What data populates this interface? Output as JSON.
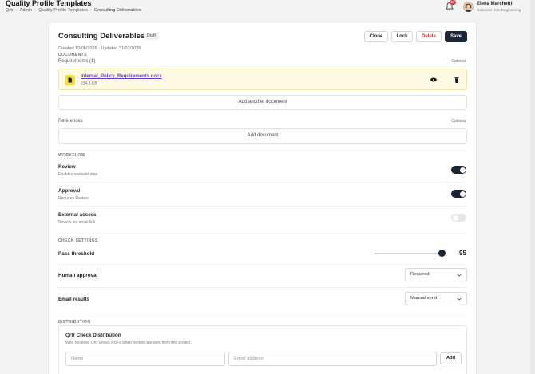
{
  "header": {
    "title": "Quality Profile Templates",
    "breadcrumbs": [
      "Qrtr",
      "Admin",
      "Quality Profile Templates",
      "Consulting Deliverables"
    ],
    "notifications_count": "13",
    "user": {
      "name": "Elena Marchetti",
      "org": "Halvorsen Kiln Engineering"
    }
  },
  "template": {
    "name": "Consulting Deliverables",
    "status": "Draft",
    "meta": "Created 10/06/2026 · Updated 31/07/2026",
    "actions": {
      "clone": "Clone",
      "lock": "Lock",
      "delete": "Delete",
      "save": "Save"
    }
  },
  "documents": {
    "section_label": "DOCUMENTS",
    "requirements_label": "Requirements (1)",
    "requirements_optional": "Optional",
    "file": {
      "name": "Internal_Policy_Requirements.docx",
      "size": "234.3 KB"
    },
    "add_another": "Add another document",
    "references_label": "References",
    "references_optional": "Optional",
    "add_document": "Add document"
  },
  "workflow": {
    "section_label": "WORKFLOW",
    "items": [
      {
        "title": "Review",
        "subtitle": "Enables reviewer step",
        "enabled": true
      },
      {
        "title": "Approval",
        "subtitle": "Requires Review",
        "enabled": true
      },
      {
        "title": "External access",
        "subtitle": "Review via email link",
        "enabled": false
      }
    ]
  },
  "check_settings": {
    "section_label": "CHECK SETTINGS",
    "pass_threshold_label": "Pass threshold",
    "pass_threshold_value": "95",
    "pass_threshold_fraction": 0.95,
    "human_approval_label": "Human approval",
    "human_approval_value": "Required",
    "email_results_label": "Email results",
    "email_results_value": "Manual send"
  },
  "distribution": {
    "section_label": "DISTRIBUTION",
    "title": "Qrtr Check Distribution",
    "subtitle": "Who receives Qrtr Check PDFs when reports are sent from this project.",
    "name_placeholder": "Name",
    "email_placeholder": "Email address",
    "add_label": "Add"
  },
  "colors": {
    "primary": "#1c2536",
    "danger": "#d12a2a",
    "file_highlight": "#fdfbe3",
    "link": "#6a3bb8"
  },
  "icons": [
    "bell-icon",
    "avatar",
    "file-icon",
    "eye-icon",
    "trash-icon",
    "chevron-down-icon"
  ]
}
